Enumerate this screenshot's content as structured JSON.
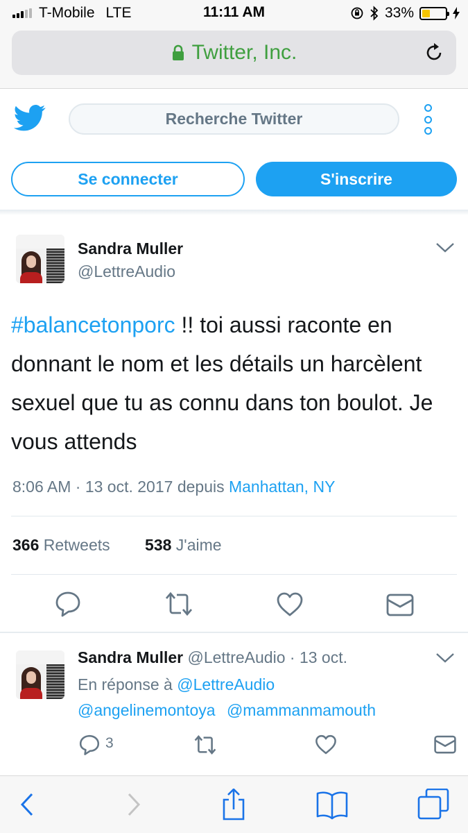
{
  "status_bar": {
    "carrier": "T-Mobile",
    "network": "LTE",
    "time": "11:11 AM",
    "battery": "33%",
    "battery_level": 0.33,
    "battery_color": "#f6c500"
  },
  "browser": {
    "url_label": "Twitter, Inc.",
    "lock_icon": "lock-icon",
    "reload_icon": "reload-icon",
    "secure_color": "#3f9f3f"
  },
  "header": {
    "logo_icon": "twitter-bird-icon",
    "search_placeholder": "Recherche Twitter",
    "more_icon": "more-dots-icon",
    "login_label": "Se connecter",
    "signup_label": "S'inscrire",
    "brand_color": "#1da1f2"
  },
  "tweet": {
    "author_name": "Sandra Muller",
    "author_handle": "@LettreAudio",
    "hashtag": "#balancetonporc",
    "text": " !!  toi aussi raconte en donnant le nom et les détails un harcèlent sexuel que tu as connu dans ton boulot. Je vous attends",
    "time_date": "8:06 AM · 13 oct. 2017 depuis ",
    "location": "Manhattan, NY",
    "retweets_count": "366",
    "retweets_label": "Retweets",
    "likes_count": "538",
    "likes_label": "J'aime",
    "actions": [
      "reply-icon",
      "retweet-icon",
      "like-icon",
      "message-icon"
    ]
  },
  "reply": {
    "author_name": "Sandra Muller",
    "author_handle": "@LettreAudio",
    "date": "· 13 oct.",
    "in_reply_label": "En réponse à",
    "mention_1": "@LettreAudio",
    "mention_2": "@angelinemontoya",
    "mention_3": "@mammanmamouth",
    "reply_count": "3",
    "actions": [
      "reply-icon",
      "retweet-icon",
      "like-icon",
      "message-icon"
    ]
  },
  "toolbar": {
    "icons": [
      "back-icon",
      "forward-icon",
      "share-icon",
      "bookmarks-icon",
      "tabs-icon"
    ]
  }
}
